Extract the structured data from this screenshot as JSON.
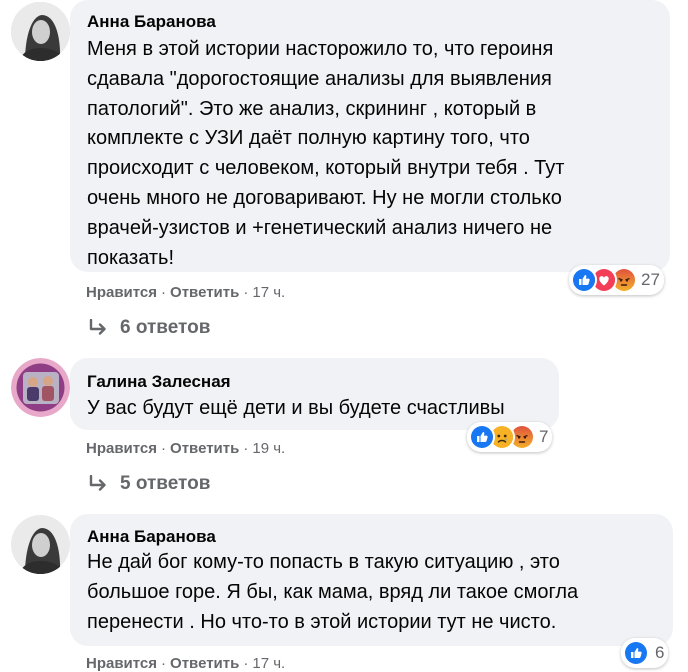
{
  "comments": [
    {
      "author": "Анна Баранова",
      "text": "Меня в этой истории насторожило то, что героиня\nсдавала \"дорогостоящие анализы для выявления\nпатологий\". Это же анализ, скрининг , который в\nкомплекте с УЗИ даёт полную картину того, что\nпроисходит с человеком, который внутри тебя . Тут\nочень много не договаривают. Ну не могли столько\nврачей-узистов и +генетический анализ ничего не\nпоказать!",
      "reactions": [
        "like-icon",
        "love-icon",
        "angry-icon"
      ],
      "reaction_count": "27",
      "like_label": "Нравится",
      "reply_label": "Ответить",
      "time": "17 ч.",
      "replies_label": "6 ответов"
    },
    {
      "author": "Галина Залесная",
      "text": "У вас будут ещё дети и вы будете счастливы",
      "reactions": [
        "like-icon",
        "sad-icon",
        "angry-icon"
      ],
      "reaction_count": "7",
      "like_label": "Нравится",
      "reply_label": "Ответить",
      "time": "19 ч.",
      "replies_label": "5 ответов"
    },
    {
      "author": "Анна Баранова",
      "text": "Не дай бог кому-то попасть в такую ситуацию , это\nбольшое горе. Я бы, как мама, вряд ли такое смогла\nперенести . Но что-то в этой истории тут не чисто.",
      "reactions": [
        "like-icon"
      ],
      "reaction_count": "6",
      "like_label": "Нравится",
      "reply_label": "Ответить",
      "time": "17 ч."
    }
  ],
  "separator": "·",
  "colors": {
    "bubble": "#f0f2f5",
    "meta": "#65676b",
    "like": "#1877f2",
    "love": "#f33e58",
    "angry": "#e9710f",
    "sad": "#f7b125"
  }
}
